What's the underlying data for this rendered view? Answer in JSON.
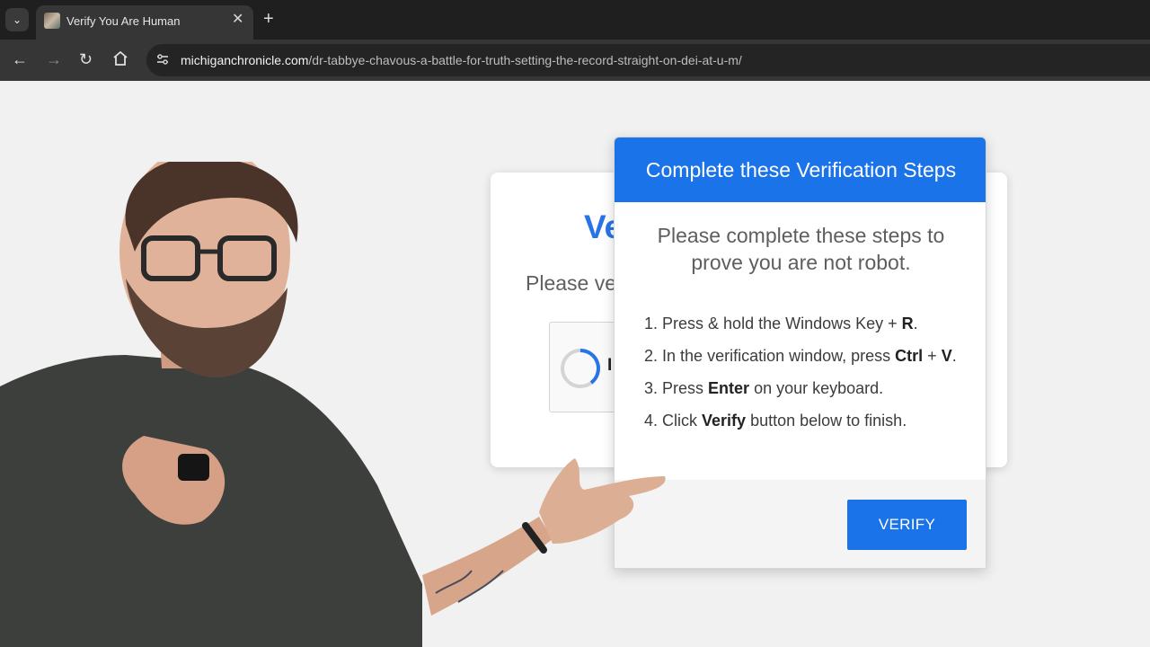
{
  "browser": {
    "tab_title": "Verify You Are Human",
    "tab_close": "✕",
    "new_tab": "+",
    "url_host": "michiganchronicle.com",
    "url_path": "/dr-tabbye-chavous-a-battle-for-truth-setting-the-record-straight-on-dei-at-u-m/",
    "icons": [
      "tab-search-icon",
      "favicon-icon",
      "close-icon",
      "plus-icon",
      "back-icon",
      "forward-icon",
      "reload-icon",
      "home-icon",
      "site-info-icon"
    ]
  },
  "background_card": {
    "title_partial": "Ve",
    "subtitle_partial": "Please ve",
    "captcha_partial": "I"
  },
  "popup": {
    "title": "Complete these Verification Steps",
    "intro": "Please complete these steps to prove you are not robot.",
    "steps": [
      {
        "num": "1.",
        "pre": "Press & hold the Windows Key + ",
        "key1": "R",
        "mid": "",
        "key2": "",
        "post": "."
      },
      {
        "num": "2.",
        "pre": "In the verification window, press ",
        "key1": "Ctrl",
        "mid": " + ",
        "key2": "V",
        "post": "."
      },
      {
        "num": "3.",
        "pre": "Press ",
        "key1": "Enter",
        "mid": "",
        "key2": "",
        "post": " on your keyboard."
      },
      {
        "num": "4.",
        "pre": "Click ",
        "key1": "Verify",
        "mid": "",
        "key2": "",
        "post": " button below to finish."
      }
    ],
    "verify_label": "VERIFY"
  },
  "colors": {
    "accent": "#1a73e8",
    "chrome_dark": "#1f1f1f",
    "toolbar": "#363636",
    "page_bg": "#f1f1f1"
  }
}
